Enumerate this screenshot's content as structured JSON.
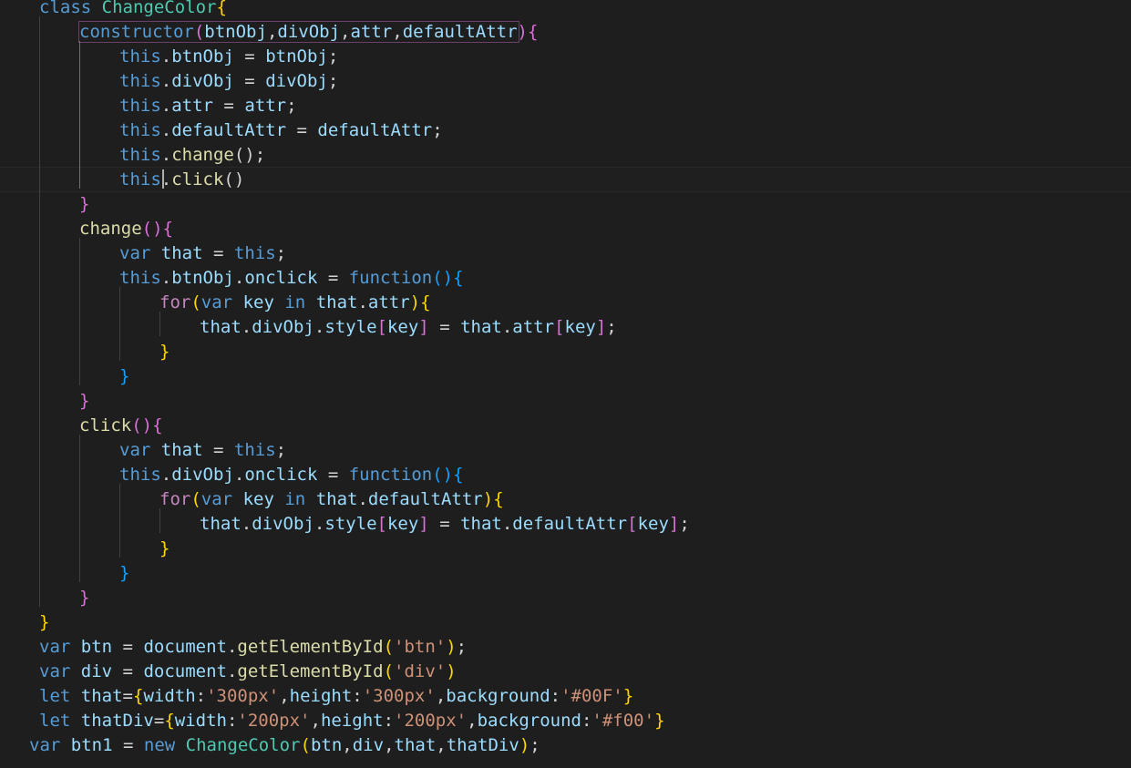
{
  "editor": {
    "language": "javascript",
    "theme": {
      "background": "#1e1e1e",
      "default_text": "#d4d4d4"
    },
    "cursor": {
      "line": 8,
      "column": 9
    },
    "lines": [
      {
        "indent": 1,
        "tokens": [
          {
            "t": "class",
            "c": "#569cd6"
          },
          {
            "t": " ",
            "c": "#d4d4d4"
          },
          {
            "t": "ChangeColor",
            "c": "#4ec9b0"
          },
          {
            "t": "{",
            "c": "#ffd700"
          }
        ]
      },
      {
        "indent": 2,
        "tokens": [
          {
            "t": "constructor",
            "c": "#569cd6"
          },
          {
            "t": "(",
            "c": "#da70d6"
          },
          {
            "t": "btnObj",
            "c": "#9cdcfe"
          },
          {
            "t": ",",
            "c": "#d4d4d4"
          },
          {
            "t": "divObj",
            "c": "#9cdcfe"
          },
          {
            "t": ",",
            "c": "#d4d4d4"
          },
          {
            "t": "attr",
            "c": "#9cdcfe"
          },
          {
            "t": ",",
            "c": "#d4d4d4"
          },
          {
            "t": "defaultAttr",
            "c": "#9cdcfe"
          },
          {
            "t": ")",
            "c": "#da70d6"
          },
          {
            "t": "{",
            "c": "#da70d6"
          }
        ]
      },
      {
        "indent": 3,
        "tokens": [
          {
            "t": "this",
            "c": "#569cd6"
          },
          {
            "t": ".",
            "c": "#d4d4d4"
          },
          {
            "t": "btnObj",
            "c": "#9cdcfe"
          },
          {
            "t": " = ",
            "c": "#d4d4d4"
          },
          {
            "t": "btnObj",
            "c": "#9cdcfe"
          },
          {
            "t": ";",
            "c": "#d4d4d4"
          }
        ]
      },
      {
        "indent": 3,
        "tokens": [
          {
            "t": "this",
            "c": "#569cd6"
          },
          {
            "t": ".",
            "c": "#d4d4d4"
          },
          {
            "t": "divObj",
            "c": "#9cdcfe"
          },
          {
            "t": " = ",
            "c": "#d4d4d4"
          },
          {
            "t": "divObj",
            "c": "#9cdcfe"
          },
          {
            "t": ";",
            "c": "#d4d4d4"
          }
        ]
      },
      {
        "indent": 3,
        "tokens": [
          {
            "t": "this",
            "c": "#569cd6"
          },
          {
            "t": ".",
            "c": "#d4d4d4"
          },
          {
            "t": "attr",
            "c": "#9cdcfe"
          },
          {
            "t": " = ",
            "c": "#d4d4d4"
          },
          {
            "t": "attr",
            "c": "#9cdcfe"
          },
          {
            "t": ";",
            "c": "#d4d4d4"
          }
        ]
      },
      {
        "indent": 3,
        "tokens": [
          {
            "t": "this",
            "c": "#569cd6"
          },
          {
            "t": ".",
            "c": "#d4d4d4"
          },
          {
            "t": "defaultAttr",
            "c": "#9cdcfe"
          },
          {
            "t": " = ",
            "c": "#d4d4d4"
          },
          {
            "t": "defaultAttr",
            "c": "#9cdcfe"
          },
          {
            "t": ";",
            "c": "#d4d4d4"
          }
        ]
      },
      {
        "indent": 3,
        "tokens": [
          {
            "t": "this",
            "c": "#569cd6"
          },
          {
            "t": ".",
            "c": "#d4d4d4"
          },
          {
            "t": "change",
            "c": "#dcdcaa"
          },
          {
            "t": "();",
            "c": "#d4d4d4"
          }
        ]
      },
      {
        "indent": 3,
        "tokens": [
          {
            "t": "this",
            "c": "#569cd6"
          },
          {
            "t": ".",
            "c": "#d4d4d4"
          },
          {
            "t": "click",
            "c": "#dcdcaa"
          },
          {
            "t": "()",
            "c": "#d4d4d4"
          }
        ]
      },
      {
        "indent": 2,
        "tokens": [
          {
            "t": "}",
            "c": "#da70d6"
          }
        ]
      },
      {
        "indent": 2,
        "tokens": [
          {
            "t": "change",
            "c": "#dcdcaa"
          },
          {
            "t": "()",
            "c": "#da70d6"
          },
          {
            "t": "{",
            "c": "#da70d6"
          }
        ]
      },
      {
        "indent": 3,
        "tokens": [
          {
            "t": "var",
            "c": "#569cd6"
          },
          {
            "t": " ",
            "c": "#d4d4d4"
          },
          {
            "t": "that",
            "c": "#9cdcfe"
          },
          {
            "t": " = ",
            "c": "#d4d4d4"
          },
          {
            "t": "this",
            "c": "#569cd6"
          },
          {
            "t": ";",
            "c": "#d4d4d4"
          }
        ]
      },
      {
        "indent": 3,
        "tokens": [
          {
            "t": "this",
            "c": "#569cd6"
          },
          {
            "t": ".",
            "c": "#d4d4d4"
          },
          {
            "t": "btnObj",
            "c": "#9cdcfe"
          },
          {
            "t": ".",
            "c": "#d4d4d4"
          },
          {
            "t": "onclick",
            "c": "#9cdcfe"
          },
          {
            "t": " = ",
            "c": "#d4d4d4"
          },
          {
            "t": "function",
            "c": "#569cd6"
          },
          {
            "t": "()",
            "c": "#179fff"
          },
          {
            "t": "{",
            "c": "#179fff"
          }
        ]
      },
      {
        "indent": 4,
        "tokens": [
          {
            "t": "for",
            "c": "#c586c0"
          },
          {
            "t": "(",
            "c": "#ffd700"
          },
          {
            "t": "var",
            "c": "#569cd6"
          },
          {
            "t": " ",
            "c": "#d4d4d4"
          },
          {
            "t": "key",
            "c": "#9cdcfe"
          },
          {
            "t": " ",
            "c": "#d4d4d4"
          },
          {
            "t": "in",
            "c": "#569cd6"
          },
          {
            "t": " ",
            "c": "#d4d4d4"
          },
          {
            "t": "that",
            "c": "#9cdcfe"
          },
          {
            "t": ".",
            "c": "#d4d4d4"
          },
          {
            "t": "attr",
            "c": "#9cdcfe"
          },
          {
            "t": ")",
            "c": "#ffd700"
          },
          {
            "t": "{",
            "c": "#ffd700"
          }
        ]
      },
      {
        "indent": 5,
        "tokens": [
          {
            "t": "that",
            "c": "#9cdcfe"
          },
          {
            "t": ".",
            "c": "#d4d4d4"
          },
          {
            "t": "divObj",
            "c": "#9cdcfe"
          },
          {
            "t": ".",
            "c": "#d4d4d4"
          },
          {
            "t": "style",
            "c": "#9cdcfe"
          },
          {
            "t": "[",
            "c": "#da70d6"
          },
          {
            "t": "key",
            "c": "#9cdcfe"
          },
          {
            "t": "]",
            "c": "#da70d6"
          },
          {
            "t": " = ",
            "c": "#d4d4d4"
          },
          {
            "t": "that",
            "c": "#9cdcfe"
          },
          {
            "t": ".",
            "c": "#d4d4d4"
          },
          {
            "t": "attr",
            "c": "#9cdcfe"
          },
          {
            "t": "[",
            "c": "#da70d6"
          },
          {
            "t": "key",
            "c": "#9cdcfe"
          },
          {
            "t": "]",
            "c": "#da70d6"
          },
          {
            "t": ";",
            "c": "#d4d4d4"
          }
        ]
      },
      {
        "indent": 4,
        "tokens": [
          {
            "t": "}",
            "c": "#ffd700"
          }
        ]
      },
      {
        "indent": 3,
        "tokens": [
          {
            "t": "}",
            "c": "#179fff"
          }
        ]
      },
      {
        "indent": 2,
        "tokens": [
          {
            "t": "}",
            "c": "#da70d6"
          }
        ]
      },
      {
        "indent": 2,
        "tokens": [
          {
            "t": "click",
            "c": "#dcdcaa"
          },
          {
            "t": "()",
            "c": "#da70d6"
          },
          {
            "t": "{",
            "c": "#da70d6"
          }
        ]
      },
      {
        "indent": 3,
        "tokens": [
          {
            "t": "var",
            "c": "#569cd6"
          },
          {
            "t": " ",
            "c": "#d4d4d4"
          },
          {
            "t": "that",
            "c": "#9cdcfe"
          },
          {
            "t": " = ",
            "c": "#d4d4d4"
          },
          {
            "t": "this",
            "c": "#569cd6"
          },
          {
            "t": ";",
            "c": "#d4d4d4"
          }
        ]
      },
      {
        "indent": 3,
        "tokens": [
          {
            "t": "this",
            "c": "#569cd6"
          },
          {
            "t": ".",
            "c": "#d4d4d4"
          },
          {
            "t": "divObj",
            "c": "#9cdcfe"
          },
          {
            "t": ".",
            "c": "#d4d4d4"
          },
          {
            "t": "onclick",
            "c": "#9cdcfe"
          },
          {
            "t": " = ",
            "c": "#d4d4d4"
          },
          {
            "t": "function",
            "c": "#569cd6"
          },
          {
            "t": "()",
            "c": "#179fff"
          },
          {
            "t": "{",
            "c": "#179fff"
          }
        ]
      },
      {
        "indent": 4,
        "tokens": [
          {
            "t": "for",
            "c": "#c586c0"
          },
          {
            "t": "(",
            "c": "#ffd700"
          },
          {
            "t": "var",
            "c": "#569cd6"
          },
          {
            "t": " ",
            "c": "#d4d4d4"
          },
          {
            "t": "key",
            "c": "#9cdcfe"
          },
          {
            "t": " ",
            "c": "#d4d4d4"
          },
          {
            "t": "in",
            "c": "#569cd6"
          },
          {
            "t": " ",
            "c": "#d4d4d4"
          },
          {
            "t": "that",
            "c": "#9cdcfe"
          },
          {
            "t": ".",
            "c": "#d4d4d4"
          },
          {
            "t": "defaultAttr",
            "c": "#9cdcfe"
          },
          {
            "t": ")",
            "c": "#ffd700"
          },
          {
            "t": "{",
            "c": "#ffd700"
          }
        ]
      },
      {
        "indent": 5,
        "tokens": [
          {
            "t": "that",
            "c": "#9cdcfe"
          },
          {
            "t": ".",
            "c": "#d4d4d4"
          },
          {
            "t": "divObj",
            "c": "#9cdcfe"
          },
          {
            "t": ".",
            "c": "#d4d4d4"
          },
          {
            "t": "style",
            "c": "#9cdcfe"
          },
          {
            "t": "[",
            "c": "#da70d6"
          },
          {
            "t": "key",
            "c": "#9cdcfe"
          },
          {
            "t": "]",
            "c": "#da70d6"
          },
          {
            "t": " = ",
            "c": "#d4d4d4"
          },
          {
            "t": "that",
            "c": "#9cdcfe"
          },
          {
            "t": ".",
            "c": "#d4d4d4"
          },
          {
            "t": "defaultAttr",
            "c": "#9cdcfe"
          },
          {
            "t": "[",
            "c": "#da70d6"
          },
          {
            "t": "key",
            "c": "#9cdcfe"
          },
          {
            "t": "]",
            "c": "#da70d6"
          },
          {
            "t": ";",
            "c": "#d4d4d4"
          }
        ]
      },
      {
        "indent": 4,
        "tokens": [
          {
            "t": "}",
            "c": "#ffd700"
          }
        ]
      },
      {
        "indent": 3,
        "tokens": [
          {
            "t": "}",
            "c": "#179fff"
          }
        ]
      },
      {
        "indent": 2,
        "tokens": [
          {
            "t": "}",
            "c": "#da70d6"
          }
        ]
      },
      {
        "indent": 1,
        "tokens": [
          {
            "t": "}",
            "c": "#ffd700"
          }
        ]
      },
      {
        "indent": 1,
        "tokens": [
          {
            "t": "var",
            "c": "#569cd6"
          },
          {
            "t": " ",
            "c": "#d4d4d4"
          },
          {
            "t": "btn",
            "c": "#9cdcfe"
          },
          {
            "t": " = ",
            "c": "#d4d4d4"
          },
          {
            "t": "document",
            "c": "#9cdcfe"
          },
          {
            "t": ".",
            "c": "#d4d4d4"
          },
          {
            "t": "getElementById",
            "c": "#dcdcaa"
          },
          {
            "t": "(",
            "c": "#ffd700"
          },
          {
            "t": "'btn'",
            "c": "#ce9178"
          },
          {
            "t": ")",
            "c": "#ffd700"
          },
          {
            "t": ";",
            "c": "#d4d4d4"
          }
        ]
      },
      {
        "indent": 1,
        "tokens": [
          {
            "t": "var",
            "c": "#569cd6"
          },
          {
            "t": " ",
            "c": "#d4d4d4"
          },
          {
            "t": "div",
            "c": "#9cdcfe"
          },
          {
            "t": " = ",
            "c": "#d4d4d4"
          },
          {
            "t": "document",
            "c": "#9cdcfe"
          },
          {
            "t": ".",
            "c": "#d4d4d4"
          },
          {
            "t": "getElementById",
            "c": "#dcdcaa"
          },
          {
            "t": "(",
            "c": "#ffd700"
          },
          {
            "t": "'div'",
            "c": "#ce9178"
          },
          {
            "t": ")",
            "c": "#ffd700"
          }
        ]
      },
      {
        "indent": 1,
        "tokens": [
          {
            "t": "let",
            "c": "#569cd6"
          },
          {
            "t": " ",
            "c": "#d4d4d4"
          },
          {
            "t": "that",
            "c": "#9cdcfe"
          },
          {
            "t": "=",
            "c": "#d4d4d4"
          },
          {
            "t": "{",
            "c": "#ffd700"
          },
          {
            "t": "width",
            "c": "#9cdcfe"
          },
          {
            "t": ":",
            "c": "#d4d4d4"
          },
          {
            "t": "'300px'",
            "c": "#ce9178"
          },
          {
            "t": ",",
            "c": "#d4d4d4"
          },
          {
            "t": "height",
            "c": "#9cdcfe"
          },
          {
            "t": ":",
            "c": "#d4d4d4"
          },
          {
            "t": "'300px'",
            "c": "#ce9178"
          },
          {
            "t": ",",
            "c": "#d4d4d4"
          },
          {
            "t": "background",
            "c": "#9cdcfe"
          },
          {
            "t": ":",
            "c": "#d4d4d4"
          },
          {
            "t": "'#00F'",
            "c": "#ce9178"
          },
          {
            "t": "}",
            "c": "#ffd700"
          }
        ]
      },
      {
        "indent": 1,
        "tokens": [
          {
            "t": "let",
            "c": "#569cd6"
          },
          {
            "t": " ",
            "c": "#d4d4d4"
          },
          {
            "t": "thatDiv",
            "c": "#9cdcfe"
          },
          {
            "t": "=",
            "c": "#d4d4d4"
          },
          {
            "t": "{",
            "c": "#ffd700"
          },
          {
            "t": "width",
            "c": "#9cdcfe"
          },
          {
            "t": ":",
            "c": "#d4d4d4"
          },
          {
            "t": "'200px'",
            "c": "#ce9178"
          },
          {
            "t": ",",
            "c": "#d4d4d4"
          },
          {
            "t": "height",
            "c": "#9cdcfe"
          },
          {
            "t": ":",
            "c": "#d4d4d4"
          },
          {
            "t": "'200px'",
            "c": "#ce9178"
          },
          {
            "t": ",",
            "c": "#d4d4d4"
          },
          {
            "t": "background",
            "c": "#9cdcfe"
          },
          {
            "t": ":",
            "c": "#d4d4d4"
          },
          {
            "t": "'#f00'",
            "c": "#ce9178"
          },
          {
            "t": "}",
            "c": "#ffd700"
          }
        ]
      },
      {
        "indent": 0,
        "tokens": [
          {
            "t": "var",
            "c": "#569cd6"
          },
          {
            "t": " ",
            "c": "#d4d4d4"
          },
          {
            "t": "btn1",
            "c": "#9cdcfe"
          },
          {
            "t": " = ",
            "c": "#d4d4d4"
          },
          {
            "t": "new",
            "c": "#569cd6"
          },
          {
            "t": " ",
            "c": "#d4d4d4"
          },
          {
            "t": "ChangeColor",
            "c": "#4ec9b0"
          },
          {
            "t": "(",
            "c": "#ffd700"
          },
          {
            "t": "btn",
            "c": "#9cdcfe"
          },
          {
            "t": ",",
            "c": "#d4d4d4"
          },
          {
            "t": "div",
            "c": "#9cdcfe"
          },
          {
            "t": ",",
            "c": "#d4d4d4"
          },
          {
            "t": "that",
            "c": "#9cdcfe"
          },
          {
            "t": ",",
            "c": "#d4d4d4"
          },
          {
            "t": "thatDiv",
            "c": "#9cdcfe"
          },
          {
            "t": ")",
            "c": "#ffd700"
          },
          {
            "t": ";",
            "c": "#d4d4d4"
          }
        ]
      }
    ]
  }
}
